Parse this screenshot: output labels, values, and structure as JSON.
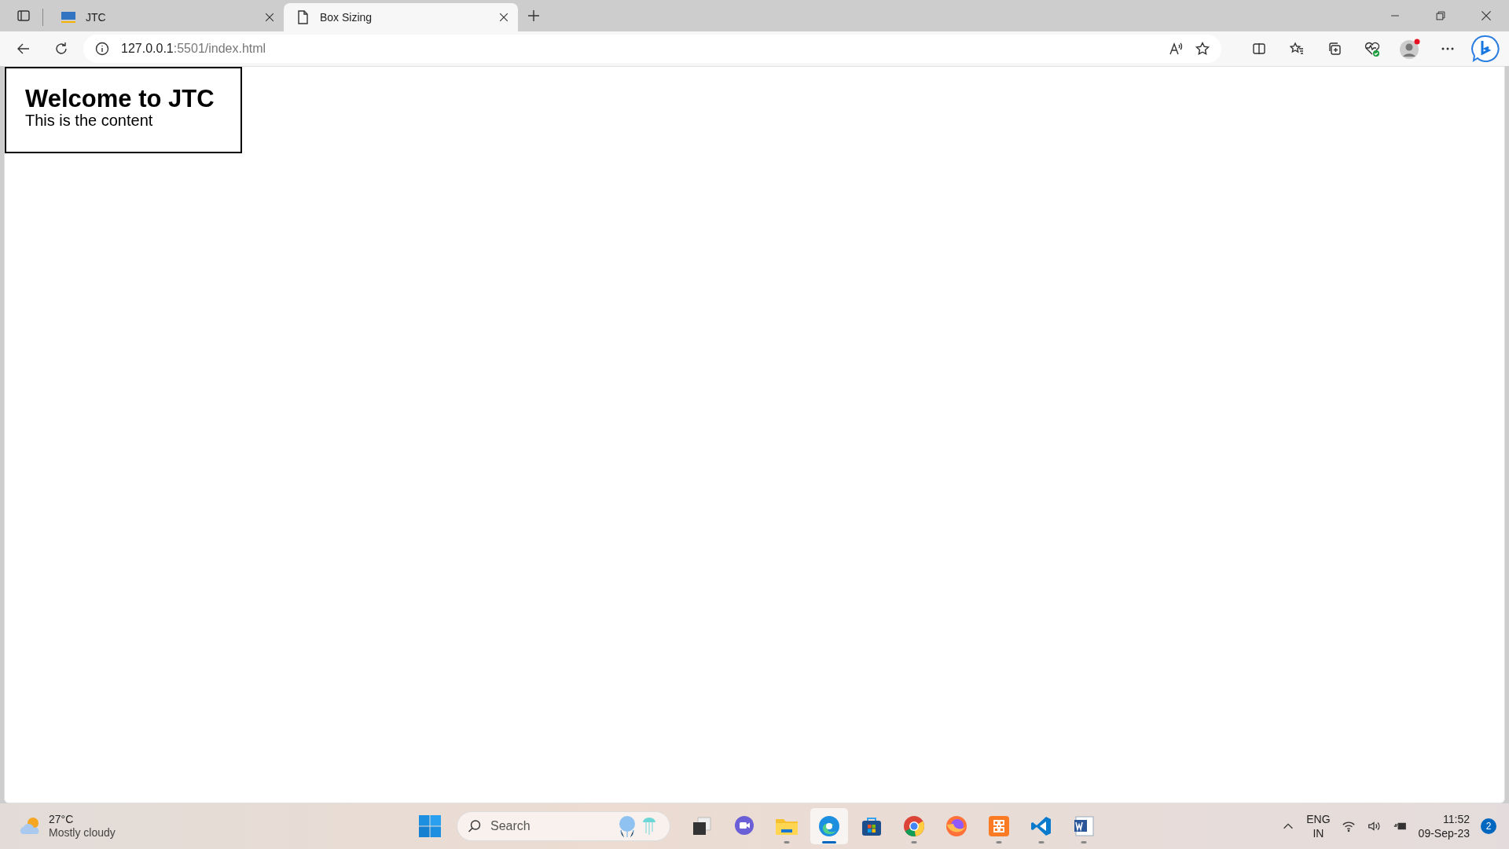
{
  "tabs": [
    {
      "title": "JTC",
      "kind": "logo",
      "selected": false
    },
    {
      "title": "Box Sizing",
      "kind": "page",
      "selected": true
    }
  ],
  "address": {
    "host": "127.0.0.1",
    "path": ":5501/index.html"
  },
  "page": {
    "heading": "Welcome to JTC",
    "text": "This is the content"
  },
  "weather": {
    "temp": "27°C",
    "condition": "Mostly cloudy"
  },
  "search": {
    "placeholder": "Search"
  },
  "apps": [
    {
      "kind": "taskview",
      "running": false,
      "selected": false
    },
    {
      "kind": "chat",
      "running": false,
      "selected": false
    },
    {
      "kind": "files",
      "running": true,
      "selected": false
    },
    {
      "kind": "edge",
      "running": true,
      "selected": true
    },
    {
      "kind": "store",
      "running": false,
      "selected": false
    },
    {
      "kind": "chrome",
      "running": true,
      "selected": false
    },
    {
      "kind": "firefox",
      "running": false,
      "selected": false
    },
    {
      "kind": "xampp",
      "running": true,
      "selected": false
    },
    {
      "kind": "vscode",
      "running": true,
      "selected": false
    },
    {
      "kind": "word",
      "running": true,
      "selected": false
    }
  ],
  "tray": {
    "lang": "ENG",
    "region": "IN",
    "time": "11:52",
    "date": "09-Sep-23",
    "notifications": "2"
  }
}
